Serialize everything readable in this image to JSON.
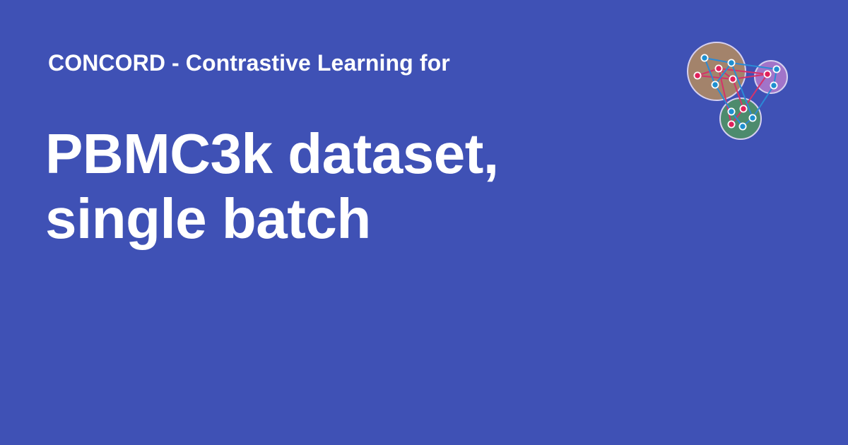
{
  "colors": {
    "background": "#3f51b5",
    "text": "#ffffff",
    "logo_cluster_brown": "#a3836b",
    "logo_cluster_purple": "#a174c9",
    "logo_cluster_green": "#4d8b6d",
    "logo_node_red": "#e0205a",
    "logo_node_blue": "#1e8fd0",
    "logo_edge_red": "#d5326a",
    "logo_edge_blue": "#2b8ad6"
  },
  "header": {
    "site_title": "CONCORD - Contrastive Learning for"
  },
  "main": {
    "title_line1": "PBMC3k dataset,",
    "title_line2": "single batch"
  },
  "logo": {
    "icon": "cluster-graph-icon"
  }
}
